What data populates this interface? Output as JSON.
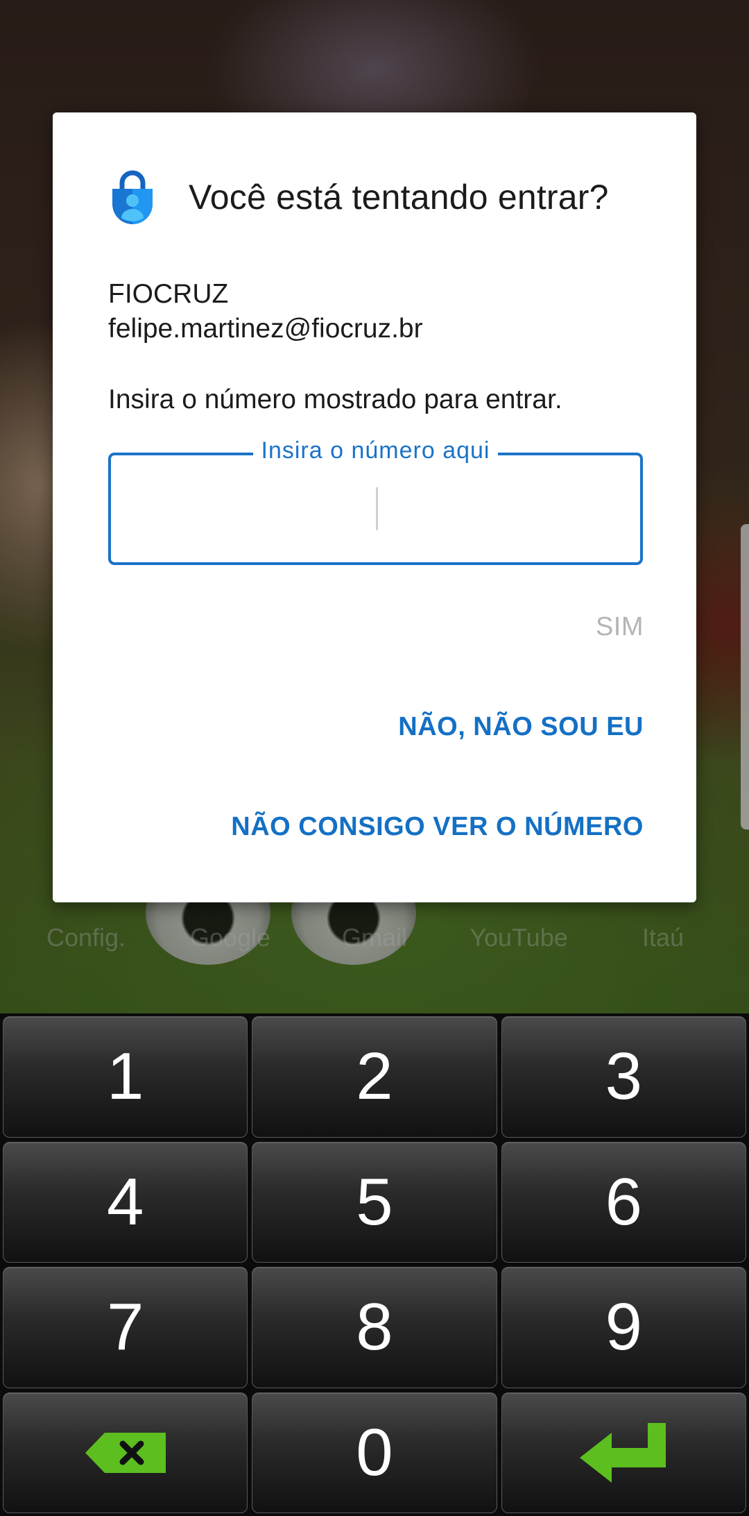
{
  "dock": {
    "labels": [
      "Config.",
      "Google",
      "Gmail",
      "YouTube",
      "Itaú"
    ]
  },
  "dialog": {
    "title": "Você está tentando entrar?",
    "organization": "FIOCRUZ",
    "account_email": "felipe.martinez@fiocruz.br",
    "instruction": "Insira o número mostrado para entrar.",
    "number_field": {
      "label": "Insira o número aqui",
      "value": ""
    },
    "actions": {
      "yes": "SIM",
      "no": "NÃO, NÃO SOU EU",
      "cant_see": "NÃO CONSIGO VER O NÚMERO"
    }
  },
  "keypad": {
    "keys": [
      "1",
      "2",
      "3",
      "4",
      "5",
      "6",
      "7",
      "8",
      "9",
      "0"
    ],
    "backspace_icon": "backspace-icon",
    "enter_icon": "enter-icon"
  },
  "colors": {
    "accent": "#1470c4",
    "field_border": "#1a73c8",
    "disabled": "#b4b4b4",
    "keypad_icon": "#5cbf1f"
  }
}
